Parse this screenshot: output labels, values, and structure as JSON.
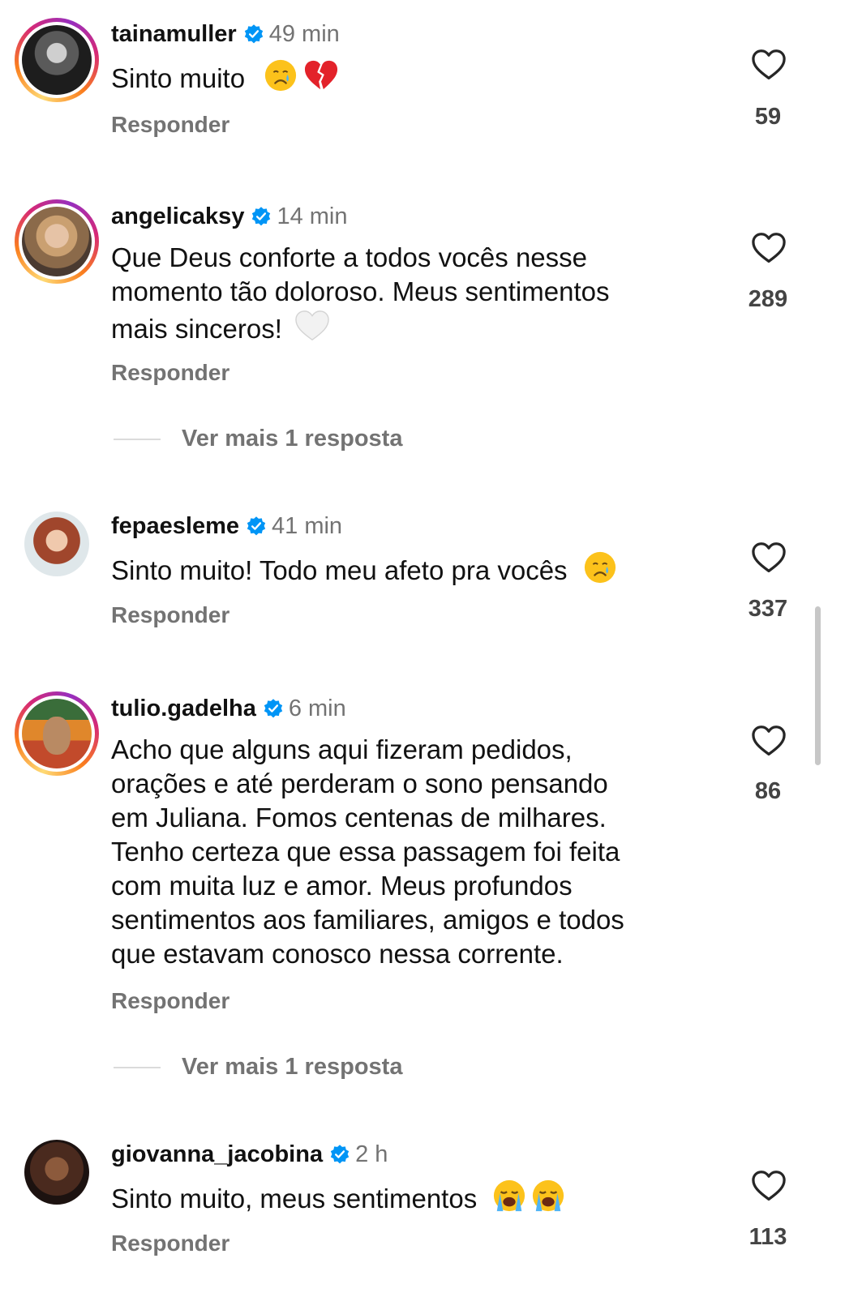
{
  "comments": [
    {
      "username": "tainamuller",
      "time": "49 min",
      "text": "Sinto muito",
      "emojis": [
        "crying-face",
        "broken-heart"
      ],
      "likes": "59",
      "reply_label": "Responder"
    },
    {
      "username": "angelicaksy",
      "time": "14 min",
      "text_lines": [
        "Que Deus conforte a todos vocês nesse",
        "momento tão doloroso. Meus sentimentos",
        "mais sinceros!"
      ],
      "emojis": [
        "white-heart"
      ],
      "likes": "289",
      "reply_label": "Responder",
      "more_replies": "Ver mais 1 resposta"
    },
    {
      "username": "fepaesleme",
      "time": "41 min",
      "text": "Sinto muito! Todo meu afeto pra vocês",
      "emojis": [
        "crying-face"
      ],
      "likes": "337",
      "reply_label": "Responder"
    },
    {
      "username": "tulio.gadelha",
      "time": "6 min",
      "text_lines": [
        "Acho que alguns aqui fizeram pedidos,",
        "orações e até perderam o sono pensando",
        "em Juliana. Fomos centenas de milhares.",
        "Tenho certeza que essa passagem foi feita",
        "com muita luz e amor. Meus profundos",
        "sentimentos aos familiares, amigos e todos",
        "que estavam conosco nessa corrente."
      ],
      "likes": "86",
      "reply_label": "Responder",
      "more_replies": "Ver mais 1 resposta"
    },
    {
      "username": "giovanna_jacobina",
      "time": "2 h",
      "text": "Sinto muito, meus sentimentos",
      "emojis": [
        "loudly-crying-face",
        "loudly-crying-face"
      ],
      "likes": "113",
      "reply_label": "Responder"
    }
  ],
  "colors": {
    "verified": "#0095f6",
    "secondary_text": "#737373",
    "primary_text": "#111111"
  }
}
